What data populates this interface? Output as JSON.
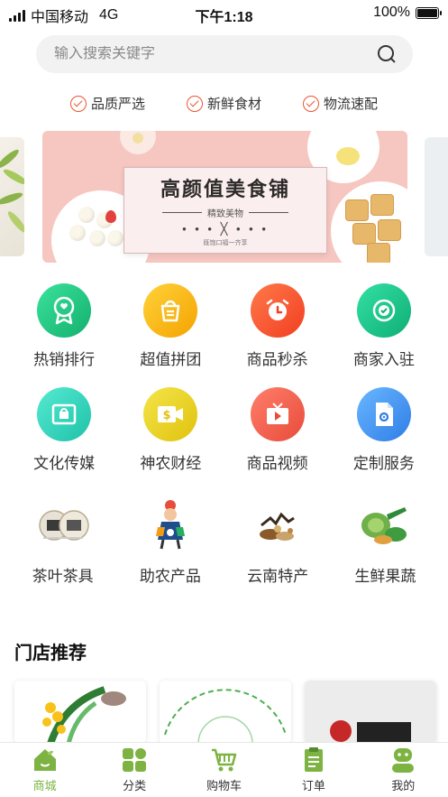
{
  "status_bar": {
    "carrier": "中国移动",
    "network": "4G",
    "time": "下午1:18",
    "battery": "100%"
  },
  "search": {
    "placeholder": "输入搜索关键字",
    "icon": "search-icon"
  },
  "features": [
    {
      "label": "品质严选",
      "icon": "check-circle-icon"
    },
    {
      "label": "新鲜食材",
      "icon": "check-circle-icon"
    },
    {
      "label": "物流速配",
      "icon": "check-circle-icon"
    }
  ],
  "banner": {
    "title": "高颜值美食铺",
    "subtitle": "精致美物",
    "deco": "• • • ╳ • • •",
    "small_text": "既饱口福一齐享"
  },
  "grid": [
    {
      "label": "热销排行",
      "icon": "ribbon-icon",
      "color": "#1fc07f"
    },
    {
      "label": "超值拼团",
      "icon": "bag-icon",
      "color": "#f7b500"
    },
    {
      "label": "商品秒杀",
      "icon": "alarm-clock-icon",
      "color": "#f44f2c"
    },
    {
      "label": "商家入驻",
      "icon": "badge-check-icon",
      "color": "#18b87b"
    },
    {
      "label": "文化传媒",
      "icon": "shopping-bag-window-icon",
      "color": "#2cccb3"
    },
    {
      "label": "神农财经",
      "icon": "dollar-camera-icon",
      "color": "#e6c915"
    },
    {
      "label": "商品视频",
      "icon": "tv-play-icon",
      "color": "#ee5a46"
    },
    {
      "label": "定制服务",
      "icon": "document-gear-icon",
      "color": "#3b8cf0"
    }
  ],
  "categories": [
    {
      "label": "茶叶茶具",
      "icon": "tea-set-image"
    },
    {
      "label": "助农产品",
      "icon": "farmer-image"
    },
    {
      "label": "云南特产",
      "icon": "specialty-image"
    },
    {
      "label": "生鲜果蔬",
      "icon": "vegetables-image"
    }
  ],
  "store_section": {
    "title": "门店推荐",
    "cards": [
      {
        "name": "",
        "icon": "plant-logo-image"
      },
      {
        "name": "",
        "icon": "rice-coop-logo-image"
      },
      {
        "name": "",
        "icon": "brand-logo-image"
      }
    ]
  },
  "tabbar": [
    {
      "label": "商城",
      "icon": "home-icon",
      "active": true
    },
    {
      "label": "分类",
      "icon": "category-icon",
      "active": false
    },
    {
      "label": "购物车",
      "icon": "cart-icon",
      "active": false
    },
    {
      "label": "订单",
      "icon": "order-icon",
      "active": false
    },
    {
      "label": "我的",
      "icon": "profile-icon",
      "active": false
    }
  ],
  "colors": {
    "accent_green": "#7cb342",
    "check_orange": "#e8552e"
  }
}
